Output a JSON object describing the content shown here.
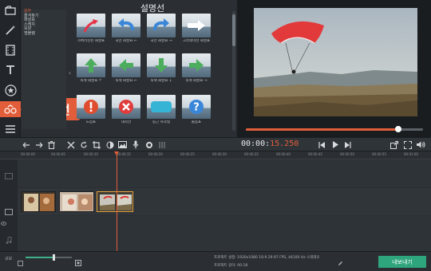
{
  "app": {
    "accent": "#e25e3a",
    "export_color": "#2ea57c"
  },
  "rail": {
    "items": [
      {
        "icon": "import-icon"
      },
      {
        "icon": "magic-wand-icon"
      },
      {
        "icon": "film-strip-icon"
      },
      {
        "icon": "text-icon"
      },
      {
        "icon": "star-icon"
      },
      {
        "icon": "callouts-icon"
      },
      {
        "icon": "list-icon"
      }
    ]
  },
  "callout_tooltip": "설명선",
  "categories": {
    "items": [
      "모두",
      "즐겨찾기",
      "화살표",
      "스케치",
      "모양",
      "엠블렘"
    ],
    "selected_index": 0
  },
  "gallery": {
    "title": "설명선",
    "tiles": [
      {
        "label": "가벼러진된 화살표",
        "icon": "red-curved-arrow-icon"
      },
      {
        "label": "곡선 화살표 ←",
        "icon": "blue-curved-arrow-icon"
      },
      {
        "label": "곡선 화살표 →",
        "icon": "blue-curved-arrow-right-icon"
      },
      {
        "label": "그라데이션 화살표",
        "icon": "white-arrow-icon"
      },
      {
        "label": "녹색 화살표 ↑",
        "icon": "green-arrow-up-icon"
      },
      {
        "label": "녹색 화살표 ←",
        "icon": "green-arrow-left-icon"
      },
      {
        "label": "녹색 화살표 ↓",
        "icon": "green-arrow-down-icon"
      },
      {
        "label": "녹색 화살표 →",
        "icon": "green-arrow-right-icon"
      },
      {
        "label": "느낌표",
        "icon": "exclamation-icon"
      },
      {
        "label": "대각선",
        "icon": "cross-icon"
      },
      {
        "label": "둥근 사각형",
        "icon": "rounded-rect-icon"
      },
      {
        "label": "물음표",
        "icon": "question-icon"
      }
    ]
  },
  "preview": {
    "progress": 0.86
  },
  "toolbar": {
    "timecode_main": "00:00:",
    "timecode_ms": "15.250",
    "tools": [
      "undo-icon",
      "redo-icon",
      "delete-icon",
      "cut-icon",
      "rotate-icon",
      "crop-icon",
      "color-icon",
      "image-icon",
      "mic-icon",
      "gear-icon",
      "equalizer-icon"
    ],
    "transport": [
      "prev-icon",
      "play-icon",
      "next-icon"
    ],
    "right": [
      "popout-icon",
      "fullscreen-icon",
      "volume-icon"
    ]
  },
  "ruler": {
    "ticks": [
      "00:00:00",
      "00:00:05",
      "00:00:10",
      "00:00:15",
      "00:00:20",
      "00:00:25",
      "00:00:30",
      "00:00:35",
      "00:00:40",
      "00:00:45",
      "00:00:50",
      "00:00:55",
      "00:01:00"
    ]
  },
  "bottom": {
    "zoom_label": "규모",
    "zoom_level": 0.62,
    "project_settings": "프로젝트 설정:  1920x1080 16:9 29.97 FPS, 44100 Hz 스테레오",
    "project_length": "프로젝트 길이:  00:18",
    "export_label": "내보내기"
  }
}
